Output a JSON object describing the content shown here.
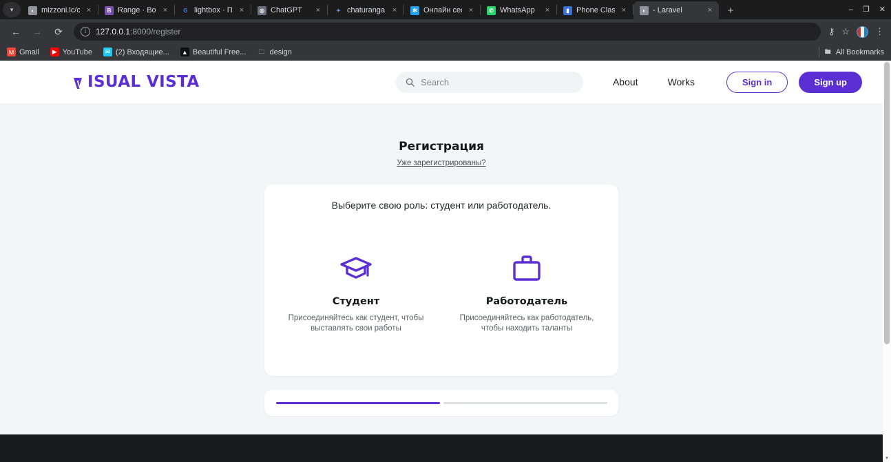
{
  "browser": {
    "tab_menu_icon": "chevron-down-icon",
    "tabs": [
      {
        "title": "mizzoni.lc/cart",
        "favicon": "globe-icon",
        "favicon_color": "#8e9499",
        "favicon_char": "◐",
        "active": false
      },
      {
        "title": "Range · Bootstr",
        "favicon": "bootstrap-icon",
        "favicon_color": "#7952b3",
        "favicon_char": "B",
        "active": false
      },
      {
        "title": "lightbox · Поис",
        "favicon": "google-icon",
        "favicon_color": "#ffffff",
        "favicon_char": "G",
        "active": false
      },
      {
        "title": "ChatGPT",
        "favicon": "chatgpt-icon",
        "favicon_color": "#6e6e80",
        "favicon_char": "◎",
        "active": false
      },
      {
        "title": "chaturanga.lc",
        "favicon": "sparkle-icon",
        "favicon_color": "#6a8fd8",
        "favicon_char": "✦",
        "active": false
      },
      {
        "title": "Онлайн сесси",
        "favicon": "flower-icon",
        "favicon_color": "#24a0ed",
        "favicon_char": "✻",
        "active": false
      },
      {
        "title": "WhatsApp",
        "favicon": "whatsapp-icon",
        "favicon_color": "#25d366",
        "favicon_char": "✆",
        "active": false
      },
      {
        "title": "Phone Classic S",
        "favicon": "bookmark-icon",
        "favicon_color": "#3b6fd4",
        "favicon_char": "▮",
        "active": false
      },
      {
        "title": "- Laravel",
        "favicon": "globe-icon",
        "favicon_color": "#8e9499",
        "favicon_char": "◐",
        "active": true
      }
    ],
    "close_label": "×",
    "new_tab_label": "+",
    "window_controls": {
      "minimize": "–",
      "maximize": "❐",
      "close": "✕"
    },
    "toolbar": {
      "back_icon": "arrow-left-icon",
      "forward_icon": "arrow-right-icon",
      "reload_icon": "reload-icon",
      "site_info_icon": "info-icon",
      "url_host": "127.0.0.1",
      "url_path": ":8000/register",
      "passwords_icon": "key-icon",
      "bookmark_icon": "star-icon",
      "profile_icon": "profile-avatar",
      "menu_icon": "three-dot-menu-icon"
    },
    "bookmarks": [
      {
        "label": "Gmail",
        "icon": "gmail-icon",
        "color": "#ea4335",
        "char": "M"
      },
      {
        "label": "YouTube",
        "icon": "youtube-icon",
        "color": "#ff0000",
        "char": "▶"
      },
      {
        "label": "(2) Входящие...",
        "icon": "mail-icon",
        "color": "#1ec8f0",
        "char": "✉"
      },
      {
        "label": "Beautiful Free...",
        "icon": "unsplash-icon",
        "color": "#111111",
        "char": "▲"
      },
      {
        "label": "design",
        "icon": "folder-icon",
        "color": "#9aa0a6",
        "char": "🗀"
      }
    ],
    "all_bookmarks": {
      "label": "All Bookmarks",
      "icon": "folder-icon"
    }
  },
  "site": {
    "logo": {
      "text": "ISUAL VISTA",
      "mark": "V",
      "color": "#5b2fd4"
    },
    "search": {
      "placeholder": "Search",
      "icon": "search-icon"
    },
    "nav": [
      {
        "label": "About",
        "name": "nav-about"
      },
      {
        "label": "Works",
        "name": "nav-works"
      }
    ],
    "sign_in": "Sign in",
    "sign_up": "Sign up"
  },
  "registration": {
    "title": "Регистрация",
    "already_registered": "Уже зарегистрированы?",
    "prompt": "Выберите свою роль: студент или работодатель.",
    "roles": [
      {
        "name": "Студент",
        "description": "Присоединяйтесь как студент, чтобы выставлять свои работы",
        "icon": "graduation-cap-icon"
      },
      {
        "name": "Работодатель",
        "description": "Присоединяйтесь как работодатель, чтобы находить таланты",
        "icon": "briefcase-icon"
      }
    ],
    "progress": {
      "total_steps": 2,
      "current_step": 1,
      "active_color": "#5b2fd4",
      "inactive_color": "#dedfe2"
    }
  }
}
